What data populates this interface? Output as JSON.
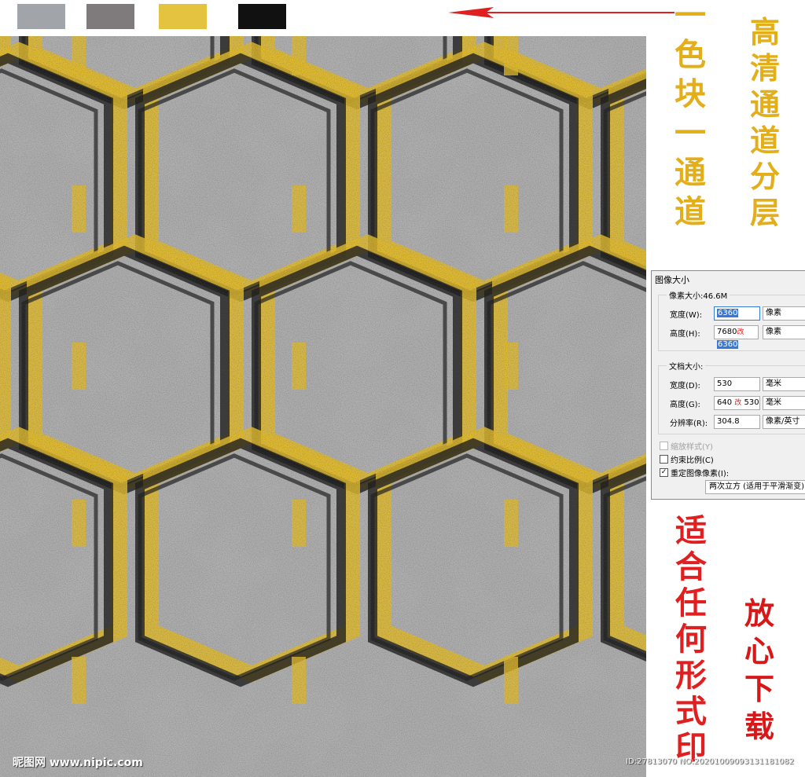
{
  "swatches": [
    {
      "name": "gray",
      "color": "#a1a4a9"
    },
    {
      "name": "taupe",
      "color": "#7f7b7c"
    },
    {
      "name": "yellow",
      "color": "#e3c340"
    },
    {
      "name": "black",
      "color": "#111111"
    }
  ],
  "arrow_color": "#e02020",
  "pattern_colors": {
    "background": "#6e6e6e",
    "light": "#b8b8b8",
    "gold": "#e1ba2c",
    "dark": "#1c1c1c"
  },
  "captions": {
    "gold_1": [
      "一",
      "色",
      "块",
      "一",
      "通",
      "道"
    ],
    "gold_2": [
      "高",
      "清",
      "通",
      "道",
      "分",
      "层"
    ],
    "red_1": [
      "适",
      "合",
      "任",
      "何",
      "形",
      "式",
      "印"
    ],
    "red_2": [
      "放",
      "心",
      "下",
      "载"
    ]
  },
  "dialog": {
    "title": "图像大小",
    "pixel_size": "像素大小:46.6M",
    "width_label": "宽度(W):",
    "width_value": "6360",
    "width_unit": "像素",
    "height_label": "高度(H):",
    "height_value_old": "7680",
    "height_mark": "改",
    "height_value_new": "6360",
    "height_unit": "像素",
    "doc_size": "文档大小:",
    "doc_width_label": "宽度(D):",
    "doc_width_value": "530",
    "doc_width_unit": "毫米",
    "doc_height_label": "高度(G):",
    "doc_height_value_old": "640",
    "doc_height_mark": "改",
    "doc_height_value_new": "530",
    "doc_height_unit": "毫米",
    "resolution_label": "分辨率(R):",
    "resolution_value": "304.8",
    "resolution_unit": "像素/英寸",
    "scale_styles": "缩放样式(Y)",
    "constrain": "约束比例(C)",
    "resample": "重定图像像素(I):",
    "resample_method": "两次立方 (适用于平滑渐变)"
  },
  "watermark": {
    "logo": "昵图网 www.nipic.com",
    "id": "ID:27813070 NO:20201009093131181082"
  }
}
